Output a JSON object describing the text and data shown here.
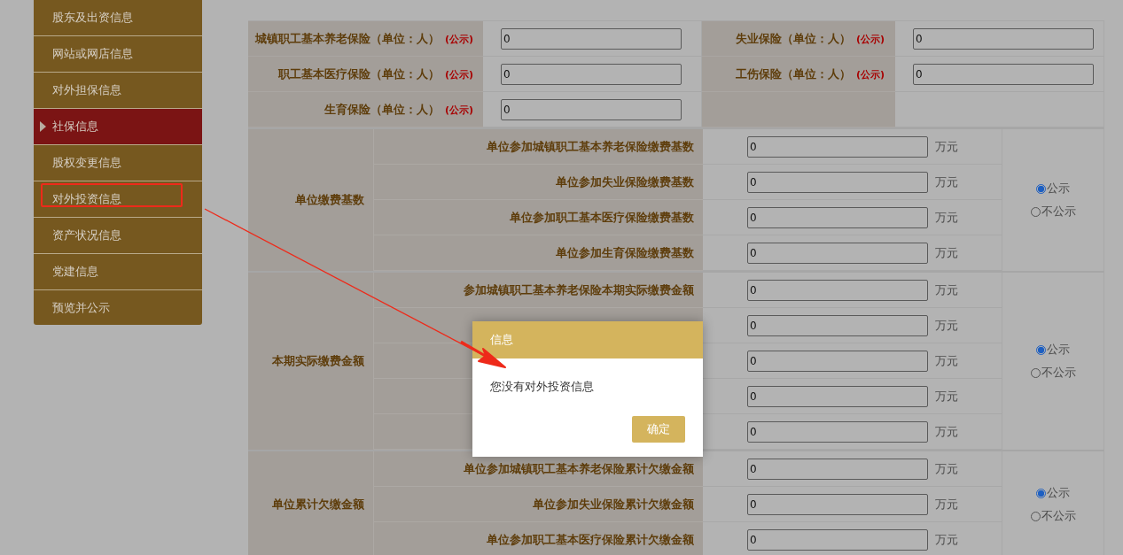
{
  "sidebar": {
    "items": [
      {
        "label": "股东及出资信息",
        "selected": false,
        "outlined": false
      },
      {
        "label": "网站或网店信息",
        "selected": false,
        "outlined": false
      },
      {
        "label": "对外担保信息",
        "selected": false,
        "outlined": false
      },
      {
        "label": "社保信息",
        "selected": true,
        "outlined": false
      },
      {
        "label": "股权变更信息",
        "selected": false,
        "outlined": false
      },
      {
        "label": "对外投资信息",
        "selected": false,
        "outlined": true
      },
      {
        "label": "资产状况信息",
        "selected": false,
        "outlined": false
      },
      {
        "label": "党建信息",
        "selected": false,
        "outlined": false
      },
      {
        "label": "预览并公示",
        "selected": false,
        "outlined": false
      }
    ]
  },
  "insured_counts": {
    "rows": [
      {
        "cells": [
          {
            "label": "城镇职工基本养老保险（单位：人）",
            "badge": "(公示)",
            "value": "0"
          },
          {
            "label": "失业保险（单位：人）",
            "badge": "(公示)",
            "value": "0"
          }
        ]
      },
      {
        "cells": [
          {
            "label": "职工基本医疗保险（单位：人）",
            "badge": "(公示)",
            "value": "0"
          },
          {
            "label": "工伤保险（单位：人）",
            "badge": "(公示)",
            "value": "0"
          }
        ]
      },
      {
        "cells": [
          {
            "label": "生育保险（单位：人）",
            "badge": "(公示)",
            "value": "0"
          }
        ]
      }
    ]
  },
  "payment_groups": [
    {
      "label": "单位缴费基数",
      "rows": [
        {
          "label": "单位参加城镇职工基本养老保险缴费基数",
          "value": "0",
          "unit": "万元"
        },
        {
          "label": "单位参加失业保险缴费基数",
          "value": "0",
          "unit": "万元"
        },
        {
          "label": "单位参加职工基本医疗保险缴费基数",
          "value": "0",
          "unit": "万元"
        },
        {
          "label": "单位参加生育保险缴费基数",
          "value": "0",
          "unit": "万元"
        }
      ],
      "options": [
        {
          "label": "公示",
          "selected": true
        },
        {
          "label": "不公示",
          "selected": false
        }
      ]
    },
    {
      "label": "本期实际缴费金额",
      "rows": [
        {
          "label": "参加城镇职工基本养老保险本期实际缴费金额",
          "value": "0",
          "unit": "万元"
        },
        {
          "value": "0",
          "unit": "万元"
        },
        {
          "value": "0",
          "unit": "万元"
        },
        {
          "value": "0",
          "unit": "万元"
        },
        {
          "value": "0",
          "unit": "万元"
        }
      ],
      "options": [
        {
          "label": "公示",
          "selected": true
        },
        {
          "label": "不公示",
          "selected": false
        }
      ]
    },
    {
      "label": "单位累计欠缴金额",
      "rows": [
        {
          "label": "单位参加城镇职工基本养老保险累计欠缴金额",
          "value": "0",
          "unit": "万元"
        },
        {
          "label": "单位参加失业保险累计欠缴金额",
          "value": "0",
          "unit": "万元"
        },
        {
          "label": "单位参加职工基本医疗保险累计欠缴金额",
          "value": "0",
          "unit": "万元"
        }
      ],
      "options": [
        {
          "label": "公示",
          "selected": true
        },
        {
          "label": "不公示",
          "selected": false
        }
      ]
    }
  ],
  "dialog": {
    "title": "信息",
    "message": "您没有对外投资信息",
    "button": "确定"
  }
}
